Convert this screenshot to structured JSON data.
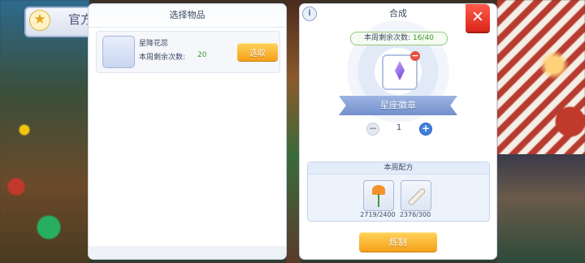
{
  "background": {
    "official_label": "官方"
  },
  "select_panel": {
    "title": "选择物品",
    "item": {
      "name": "星降花蕊",
      "remain_label": "本周剩余次数:",
      "remain_value": "20",
      "select_button": "选取",
      "icon": "flower-crystal-icon"
    }
  },
  "craft_panel": {
    "title": "合成",
    "weekly_remaining_label": "本周剩余次数:",
    "weekly_remaining_value": "16/40",
    "target_item_name": "星座徽章",
    "quantity": "1",
    "recipe_title": "本周配方",
    "materials": [
      {
        "icon": "flower-icon",
        "count": "2719/2400"
      },
      {
        "icon": "bone-icon",
        "count": "2376/300"
      }
    ],
    "refine_button": "炼制"
  },
  "colors": {
    "accent_button": "#f6a019",
    "close_button": "#d9261a",
    "positive_value": "#3c9a2c",
    "ribbon": "#7390cd"
  }
}
